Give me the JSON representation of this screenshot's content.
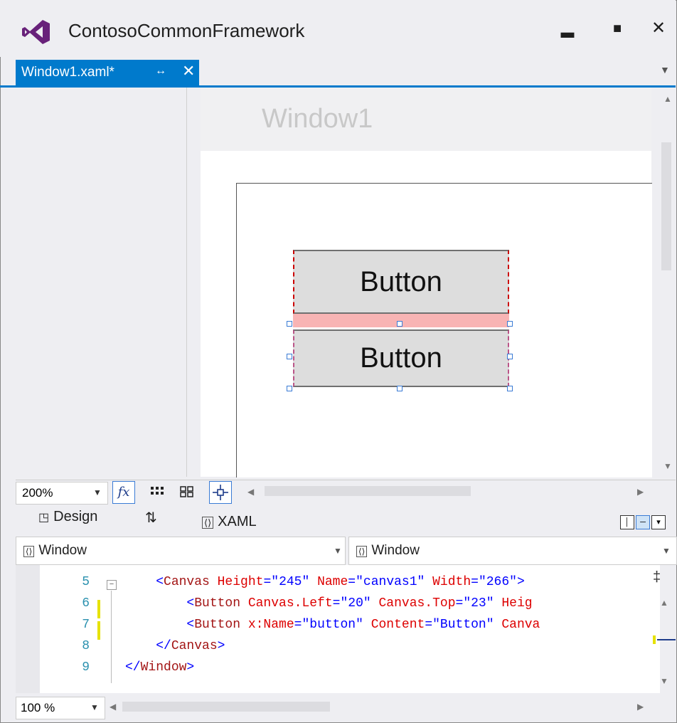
{
  "window": {
    "title": "ContosoCommonFramework",
    "minimize_glyph": "▂",
    "maximize_glyph": "■",
    "close_glyph": "✕"
  },
  "tab": {
    "label": "Window1.xaml*",
    "pin_glyph": "↔",
    "close_glyph": "✕"
  },
  "designer": {
    "window_title": "Window1",
    "buttons": [
      {
        "content": "Button"
      },
      {
        "content": "Button"
      }
    ]
  },
  "zoom_toolbar": {
    "zoom": "200%",
    "fx_label": "fx"
  },
  "split_tabs": {
    "design": "Design",
    "swap_glyph": "⇅",
    "xaml": "XAML"
  },
  "scope": {
    "left": "Window",
    "right": "Window"
  },
  "code_lines": [
    {
      "num": "5",
      "tokens": [
        {
          "t": "    <",
          "c": "blue"
        },
        {
          "t": "Canvas",
          "c": "maroon"
        },
        {
          "t": " Height",
          "c": "red"
        },
        {
          "t": "=",
          "c": "blue"
        },
        {
          "t": "\"245\"",
          "c": "blue"
        },
        {
          "t": " Name",
          "c": "red"
        },
        {
          "t": "=",
          "c": "blue"
        },
        {
          "t": "\"canvas1\"",
          "c": "blue"
        },
        {
          "t": " Width",
          "c": "red"
        },
        {
          "t": "=",
          "c": "blue"
        },
        {
          "t": "\"266\"",
          "c": "blue"
        },
        {
          "t": ">",
          "c": "blue"
        }
      ]
    },
    {
      "num": "6",
      "tokens": [
        {
          "t": "        <",
          "c": "blue"
        },
        {
          "t": "Button",
          "c": "maroon"
        },
        {
          "t": " Canvas.Left",
          "c": "red"
        },
        {
          "t": "=",
          "c": "blue"
        },
        {
          "t": "\"20\"",
          "c": "blue"
        },
        {
          "t": " Canvas.Top",
          "c": "red"
        },
        {
          "t": "=",
          "c": "blue"
        },
        {
          "t": "\"23\"",
          "c": "blue"
        },
        {
          "t": " Heig",
          "c": "red"
        }
      ]
    },
    {
      "num": "7",
      "tokens": [
        {
          "t": "        <",
          "c": "blue"
        },
        {
          "t": "Button",
          "c": "maroon"
        },
        {
          "t": " x:Name",
          "c": "red"
        },
        {
          "t": "=",
          "c": "blue"
        },
        {
          "t": "\"button\"",
          "c": "blue"
        },
        {
          "t": " Content",
          "c": "red"
        },
        {
          "t": "=",
          "c": "blue"
        },
        {
          "t": "\"Button\"",
          "c": "blue"
        },
        {
          "t": " Canva",
          "c": "red"
        }
      ]
    },
    {
      "num": "8",
      "tokens": [
        {
          "t": "    </",
          "c": "blue"
        },
        {
          "t": "Canvas",
          "c": "maroon"
        },
        {
          "t": ">",
          "c": "blue"
        }
      ]
    },
    {
      "num": "9",
      "tokens": [
        {
          "t": "</",
          "c": "blue"
        },
        {
          "t": "Window",
          "c": "maroon"
        },
        {
          "t": ">",
          "c": "blue"
        }
      ]
    }
  ],
  "editor_zoom": "100 %",
  "colors": {
    "accent": "#007acc",
    "vs_purple": "#68217a"
  }
}
